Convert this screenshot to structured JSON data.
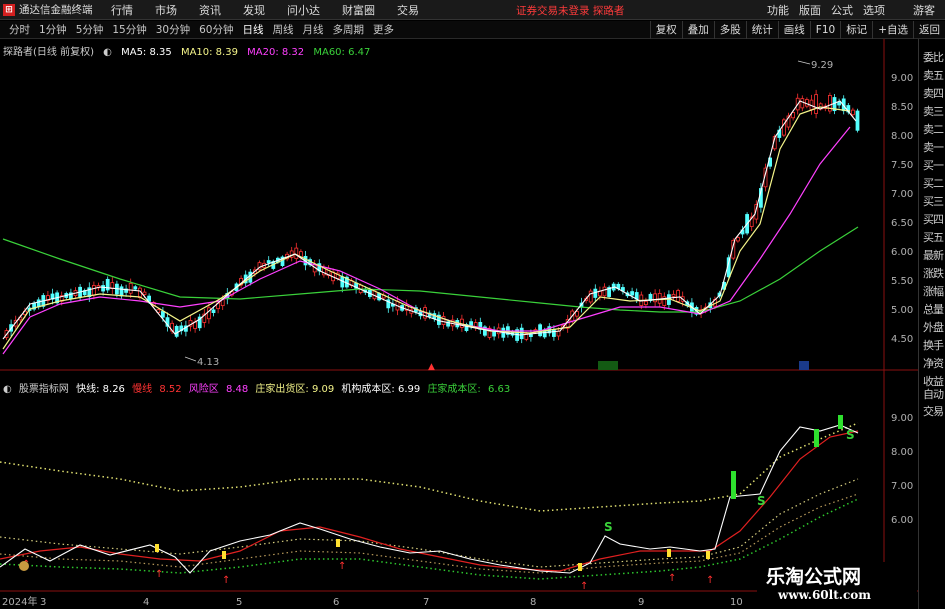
{
  "app": {
    "title": "通达信金融终端",
    "login_status": "证券交易未登录  探路者",
    "guest": "游客"
  },
  "menu": [
    "行情",
    "市场",
    "资讯",
    "发现",
    "问小达",
    "财富圈",
    "交易"
  ],
  "top_right": [
    "功能",
    "版面",
    "公式",
    "选项"
  ],
  "periods": [
    "分时",
    "1分钟",
    "5分钟",
    "15分钟",
    "30分钟",
    "60分钟",
    "日线",
    "周线",
    "月线",
    "多周期",
    "更多"
  ],
  "active_period": "日线",
  "toolbar_right": [
    "复权",
    "叠加",
    "多股",
    "统计",
    "画线",
    "F10",
    "标记",
    "+自选",
    "返回"
  ],
  "main_legend": {
    "name": "探路者(日线 前复权)",
    "ma5": "MA5: 8.35",
    "ma10": "MA10: 8.39",
    "ma20": "MA20: 8.32",
    "ma60": "MA60: 6.47"
  },
  "indicator_legend": {
    "name": "股票指标网",
    "fast": "快线: 8.26",
    "slow_label": "慢线",
    "slow_val": "8.52",
    "risk_label": "风险区",
    "risk_val": "8.48",
    "dealer_out": "庄家出货区: 9.09",
    "inst_cost": "机构成本区: 6.99",
    "dealer_cost_label": "庄家成本区:",
    "dealer_cost_val": "6.63"
  },
  "annotations": {
    "high": "9.29",
    "low": "4.13"
  },
  "price_axis": [
    "9.00",
    "8.50",
    "8.00",
    "7.50",
    "7.00",
    "6.50",
    "6.00",
    "5.50",
    "5.00",
    "4.50"
  ],
  "ind_axis": [
    "9.00",
    "8.00",
    "7.00",
    "6.00"
  ],
  "date_axis": [
    "2024年",
    "3",
    "4",
    "5",
    "6",
    "7",
    "8",
    "9",
    "10"
  ],
  "right_panel": [
    "委比",
    "卖五",
    "卖四",
    "卖三",
    "卖二",
    "卖一",
    "买一",
    "买二",
    "买三",
    "买四",
    "买五",
    "最新",
    "涨跌",
    "涨幅",
    "总量",
    "外盘",
    "换手",
    "净资",
    "收益"
  ],
  "right_panel_bottom": [
    "自动",
    "交易"
  ],
  "watermark": {
    "title": "乐淘公式网",
    "url": "www.60lt.com"
  },
  "colors": {
    "up": "#ff3232",
    "down": "#54ffff",
    "ma5": "#ffffff",
    "ma10": "#f5f58a",
    "ma20": "#ff40ff",
    "ma60": "#3ad13a"
  }
}
